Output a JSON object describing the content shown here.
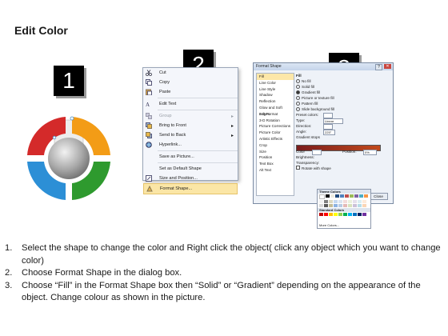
{
  "title": "Edit Color",
  "steps": [
    "1",
    "2",
    "3"
  ],
  "context_menu": {
    "items": [
      {
        "label": "Cut",
        "icon": "scissors-icon"
      },
      {
        "label": "Copy",
        "icon": "copy-icon"
      },
      {
        "label": "Paste",
        "icon": "paste-icon"
      },
      {
        "label": "Edit Text",
        "icon": "edit-text-icon"
      },
      {
        "label": "Group",
        "icon": "group-icon",
        "disabled": true,
        "submenu": true
      },
      {
        "label": "Bring to Front",
        "icon": "bring-front-icon",
        "submenu": true
      },
      {
        "label": "Send to Back",
        "icon": "send-back-icon",
        "submenu": true
      },
      {
        "label": "Hyperlink...",
        "icon": "hyperlink-icon"
      },
      {
        "label": "Save as Picture...",
        "icon": ""
      },
      {
        "label": "Set as Default Shape",
        "icon": ""
      },
      {
        "label": "Size and Position...",
        "icon": "size-icon"
      },
      {
        "label": "Format Shape...",
        "icon": "format-shape-icon",
        "highlighted": true
      }
    ]
  },
  "dialog": {
    "title": "Format Shape",
    "categories": [
      "Fill",
      "Line Color",
      "Line Style",
      "Shadow",
      "Reflection",
      "Glow and Soft Edges",
      "3-D Format",
      "3-D Rotation",
      "Picture Corrections",
      "Picture Color",
      "Artistic Effects",
      "Crop",
      "Size",
      "Position",
      "Text Box",
      "Alt Text"
    ],
    "section": "Fill",
    "options": [
      "No fill",
      "Solid fill",
      "Gradient fill",
      "Picture or texture fill",
      "Pattern fill",
      "Slide background fill"
    ],
    "fields": [
      {
        "label": "Preset colors:",
        "value": ""
      },
      {
        "label": "Type:",
        "value": "Linear"
      },
      {
        "label": "Direction:",
        "value": ""
      },
      {
        "label": "Angle:",
        "value": "225°"
      }
    ],
    "gradient_stops_label": "Gradient stops",
    "color_label": "Color",
    "position_label": "Position:",
    "position_value": "0%",
    "brightness_label": "Brightness:",
    "transparency_label": "Transparency:",
    "rotate_label": "Rotate with shape",
    "close_label": "Close"
  },
  "palette": {
    "theme_label": "Theme Colors",
    "standard_label": "Standard Colors",
    "recent_label": "Recent Colors",
    "more_label": "More Colors..."
  },
  "instructions": [
    {
      "n": "1.",
      "text": "Select the shape to change the color and Right click the object( click any object which you want to change color)"
    },
    {
      "n": "2.",
      "text": "Choose Format Shape in the dialog box."
    },
    {
      "n": "3.",
      "text": "Choose “Fill” in the Format Shape box then “Solid” or “Gradient” depending on the appearance of the object. Change colour as shown in the picture."
    }
  ],
  "colors": {
    "red": "#d42a2a",
    "orange": "#f39c16",
    "blue": "#2c8fd6",
    "green": "#2e9a2e",
    "highlight": "#fbe6a6"
  }
}
